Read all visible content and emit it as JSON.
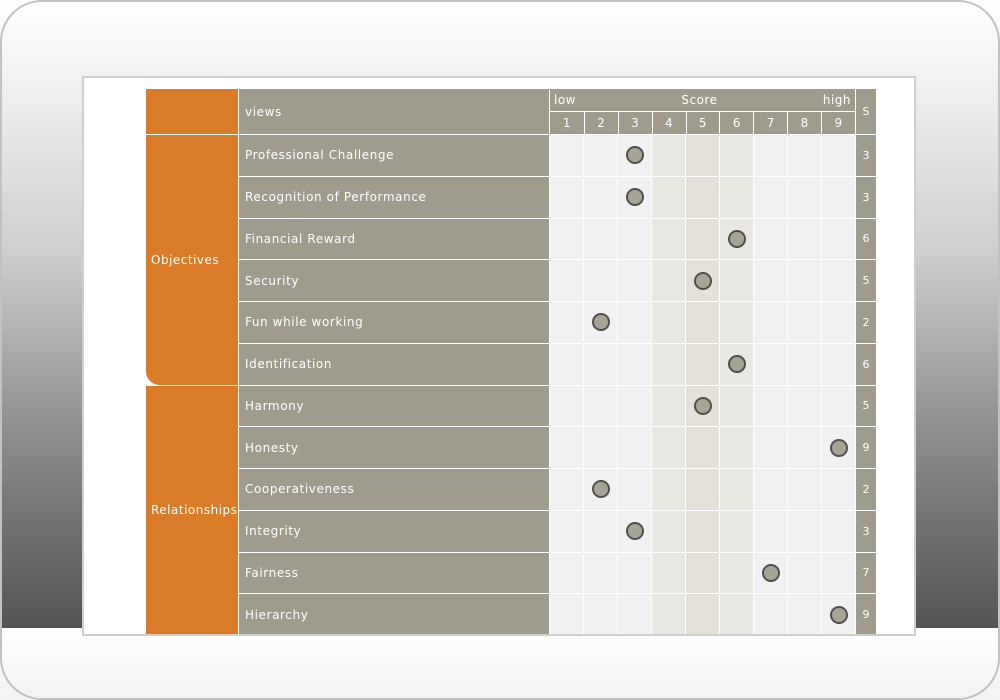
{
  "header": {
    "views_label": "views",
    "score_title": "Score",
    "low_label": "low",
    "high_label": "high",
    "s_label": "S",
    "scale": [
      "1",
      "2",
      "3",
      "4",
      "5",
      "6",
      "7",
      "8",
      "9"
    ]
  },
  "groups": [
    {
      "label": "Objectives",
      "rows": [
        {
          "label": "Professional Challenge",
          "score": 3
        },
        {
          "label": "Recognition of Performance",
          "score": 3
        },
        {
          "label": "Financial Reward",
          "score": 6
        },
        {
          "label": "Security",
          "score": 5
        },
        {
          "label": "Fun while working",
          "score": 2
        },
        {
          "label": "Identification",
          "score": 6
        }
      ]
    },
    {
      "label": "Relationships",
      "rows": [
        {
          "label": "Harmony",
          "score": 5
        },
        {
          "label": "Honesty",
          "score": 9
        },
        {
          "label": "Cooperativeness",
          "score": 2
        },
        {
          "label": "Integrity",
          "score": 3
        },
        {
          "label": "Fairness",
          "score": 7
        },
        {
          "label": "Hierarchy",
          "score": 9
        }
      ]
    }
  ],
  "colors": {
    "accent_orange": "#d97b27",
    "row_gray": "#a09c8d",
    "marker_fill": "#a7a395"
  }
}
